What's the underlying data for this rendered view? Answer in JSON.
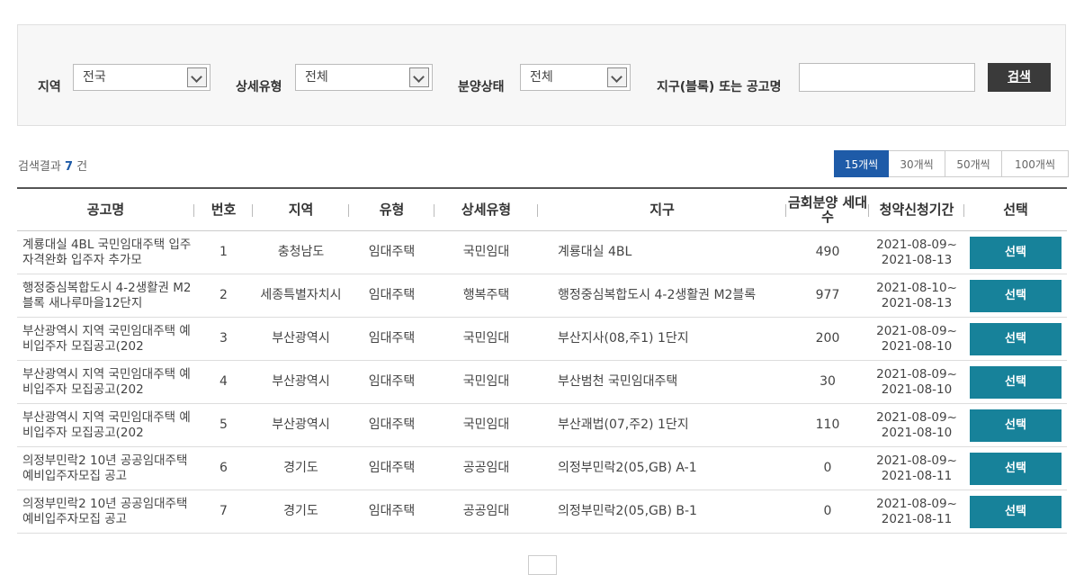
{
  "filter": {
    "region_label": "지역",
    "region_value": "전국",
    "detail_type_label": "상세유형",
    "detail_type_value": "전체",
    "sale_status_label": "분양상태",
    "sale_status_value": "전체",
    "keyword_label": "지구(블록) 또는 공고명",
    "keyword_value": "",
    "search_button": "검색"
  },
  "results": {
    "prefix": "검색결과",
    "count": "7",
    "suffix": "건"
  },
  "page_size_options": [
    "15개씩",
    "30개씩",
    "50개씩",
    "100개씩"
  ],
  "page_size_active": "15개씩",
  "table": {
    "headers": [
      "공고명",
      "번호",
      "지역",
      "유형",
      "상세유형",
      "지구",
      "금회분양 세대수",
      "청약신청기간",
      "선택"
    ],
    "rows": [
      {
        "title": "계룡대실 4BL 국민임대주택 입주자격완화 입주자 추가모",
        "no": "1",
        "region": "충청남도",
        "type": "임대주택",
        "detail": "국민임대",
        "district": "계룡대실 4BL",
        "units": "490",
        "period_start": "2021-08-09~",
        "period_end": "2021-08-13",
        "button": "선택"
      },
      {
        "title": "행정중심복합도시 4-2생활권 M2블록 새나루마을12단지",
        "no": "2",
        "region": "세종특별자치시",
        "type": "임대주택",
        "detail": "행복주택",
        "district": "행정중심복합도시 4-2생활권 M2블록",
        "units": "977",
        "period_start": "2021-08-10~",
        "period_end": "2021-08-13",
        "button": "선택"
      },
      {
        "title": "부산광역시 지역 국민임대주택 예비입주자 모집공고(202",
        "no": "3",
        "region": "부산광역시",
        "type": "임대주택",
        "detail": "국민임대",
        "district": "부산지사(08,주1) 1단지",
        "units": "200",
        "period_start": "2021-08-09~",
        "period_end": "2021-08-10",
        "button": "선택"
      },
      {
        "title": "부산광역시 지역 국민임대주택 예비입주자 모집공고(202",
        "no": "4",
        "region": "부산광역시",
        "type": "임대주택",
        "detail": "국민임대",
        "district": "부산범천 국민임대주택",
        "units": "30",
        "period_start": "2021-08-09~",
        "period_end": "2021-08-10",
        "button": "선택"
      },
      {
        "title": "부산광역시 지역 국민임대주택 예비입주자 모집공고(202",
        "no": "5",
        "region": "부산광역시",
        "type": "임대주택",
        "detail": "국민임대",
        "district": "부산괘법(07,주2) 1단지",
        "units": "110",
        "period_start": "2021-08-09~",
        "period_end": "2021-08-10",
        "button": "선택"
      },
      {
        "title": "의정부민락2 10년 공공임대주택 예비입주자모집 공고",
        "no": "6",
        "region": "경기도",
        "type": "임대주택",
        "detail": "공공임대",
        "district": "의정부민락2(05,GB) A-1",
        "units": "0",
        "period_start": "2021-08-09~",
        "period_end": "2021-08-11",
        "button": "선택"
      },
      {
        "title": "의정부민락2 10년 공공임대주택 예비입주자모집 공고",
        "no": "7",
        "region": "경기도",
        "type": "임대주택",
        "detail": "공공임대",
        "district": "의정부민락2(05,GB) B-1",
        "units": "0",
        "period_start": "2021-08-09~",
        "period_end": "2021-08-11",
        "button": "선택"
      }
    ]
  }
}
